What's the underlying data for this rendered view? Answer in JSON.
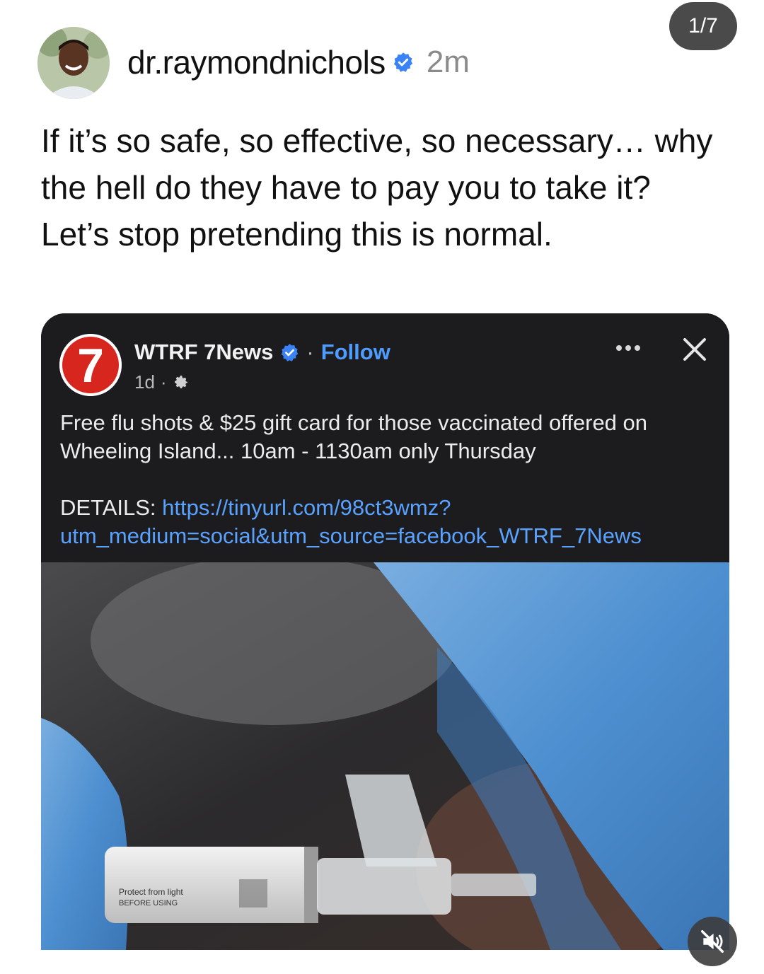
{
  "story": {
    "counter": "1/7"
  },
  "author": {
    "username": "dr.raymondnichols",
    "verified": true,
    "time": "2m"
  },
  "post": {
    "lines": [
      "If it’s so safe, so effective, so necessary… why the hell do they have to pay you to take it?",
      "Let’s stop pretending this is normal."
    ]
  },
  "embedded_post": {
    "page_name": "WTRF 7News",
    "separator": "·",
    "follow_label": "Follow",
    "age": "1d",
    "age_separator": "·",
    "body": "Free flu shots & $25 gift card for those vaccinated offered on Wheeling Island... 10am - 1130am only Thursday",
    "details_label": "DETAILS:",
    "details_url": "https://tinyurl.com/98ct3wmz?utm_medium=social&utm_source=facebook_WTRF_7News",
    "logo_text": "7",
    "photo_label_lines": [
      "Protect from light",
      "BEFORE USING"
    ]
  },
  "colors": {
    "link": "#5aa2ff",
    "verified_badge": "#3b82f6",
    "card_background": "#1c1c1e",
    "glove": "#4d8fd0"
  },
  "icons": [
    "verified-badge-icon",
    "settings-icon",
    "more-icon",
    "close-icon",
    "muted-speaker-icon"
  ]
}
